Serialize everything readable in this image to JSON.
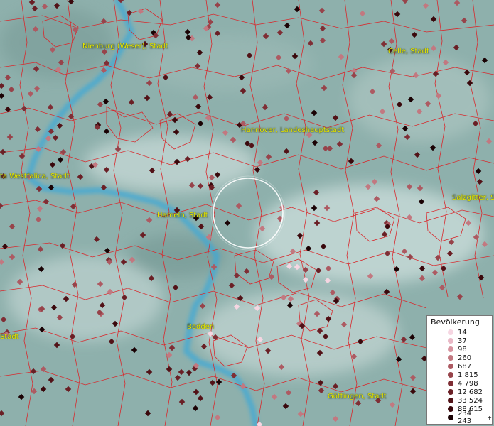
{
  "map": {
    "labels": [
      {
        "id": "nienburg",
        "text": "Nienburg (Weser), Stadt"
      },
      {
        "id": "celle",
        "text": "Celle, Stadt"
      },
      {
        "id": "hannover",
        "text": "Hannover, Landeshauptstadt"
      },
      {
        "id": "porta",
        "text": "ta Westfalica, Stadt"
      },
      {
        "id": "salzgitter",
        "text": "Salzgitter, St"
      },
      {
        "id": "hameln",
        "text": "Hameln, Stadt"
      },
      {
        "id": "stadt-left",
        "text": "Stadt"
      },
      {
        "id": "bodden",
        "text": "Bodden"
      },
      {
        "id": "goettingen",
        "text": "Göttingen, Stadt"
      }
    ]
  },
  "legend": {
    "title": "Bevölkerung",
    "items": [
      {
        "label": "14",
        "color": "#f6d6e2"
      },
      {
        "label": "37",
        "color": "#e9b8c6"
      },
      {
        "label": "98",
        "color": "#d7939f"
      },
      {
        "label": "260",
        "color": "#c27880"
      },
      {
        "label": "687",
        "color": "#ad5a62"
      },
      {
        "label": "1 815",
        "color": "#97434a"
      },
      {
        "label": "4 798",
        "color": "#7f2e35"
      },
      {
        "label": "12 682",
        "color": "#6a1f25"
      },
      {
        "label": "33 524",
        "color": "#521217"
      },
      {
        "label": "88 615",
        "color": "#3a080c"
      },
      {
        "label": "234 243",
        "color": "#1a0204",
        "plus": "+"
      }
    ]
  }
}
